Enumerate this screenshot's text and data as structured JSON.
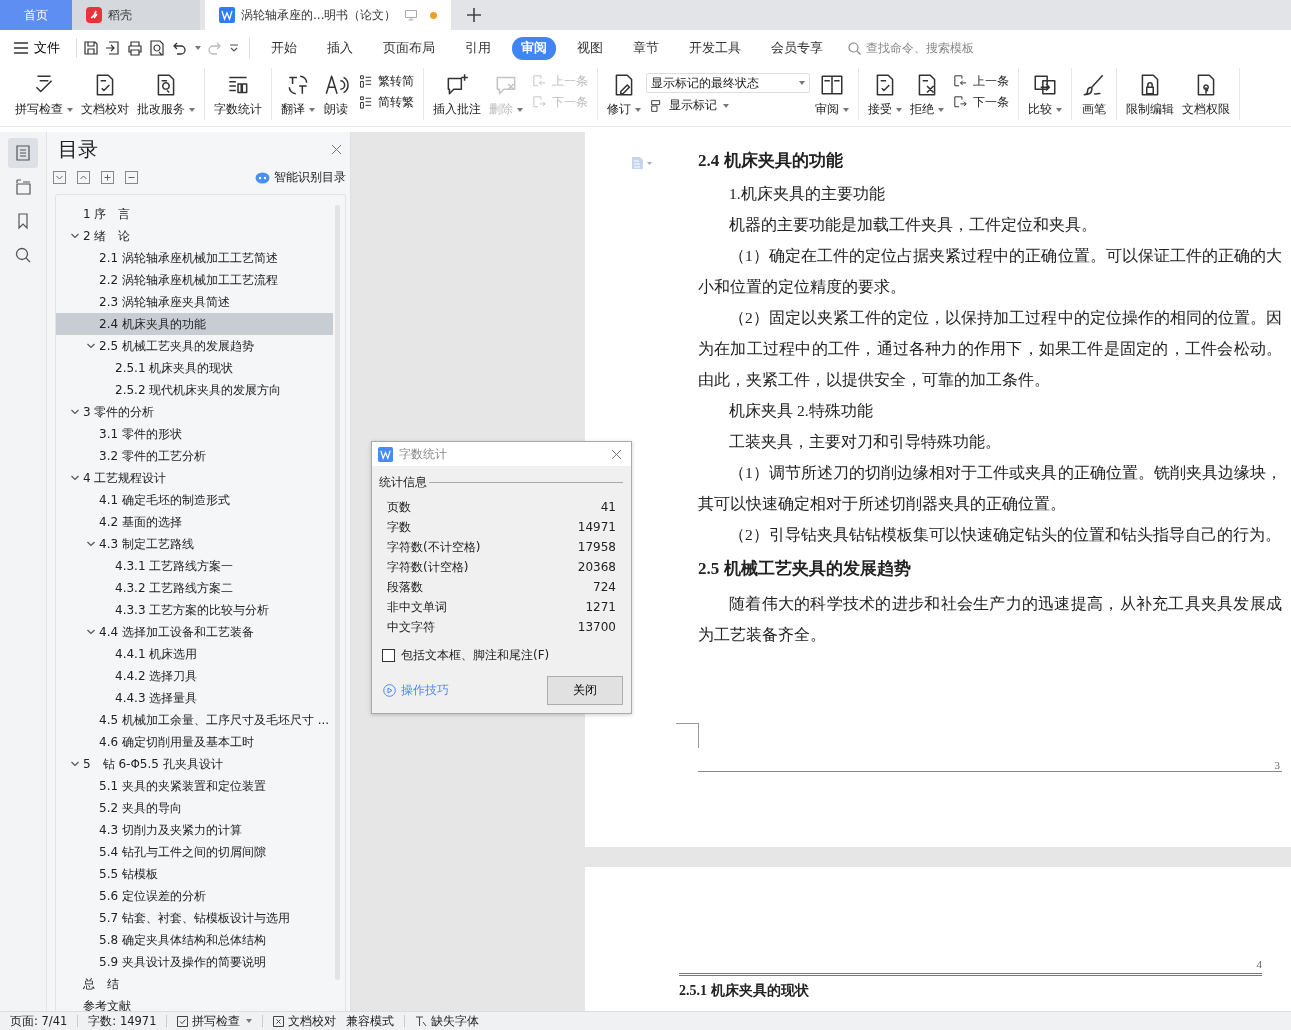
{
  "title_tabs": [
    {
      "label": "首页",
      "kind": "home",
      "selected": false
    },
    {
      "label": "稻壳",
      "kind": "app",
      "selected": false
    },
    {
      "label": "涡轮轴承座的...明书（论文）",
      "kind": "doc",
      "selected": true,
      "modified": true
    }
  ],
  "menu": {
    "file_label": "文件",
    "tabs": [
      {
        "label": "开始",
        "selected": false
      },
      {
        "label": "插入",
        "selected": false
      },
      {
        "label": "页面布局",
        "selected": false
      },
      {
        "label": "引用",
        "selected": false
      },
      {
        "label": "审阅",
        "selected": true
      },
      {
        "label": "视图",
        "selected": false
      },
      {
        "label": "章节",
        "selected": false
      },
      {
        "label": "开发工具",
        "selected": false
      },
      {
        "label": "会员专享",
        "selected": false
      }
    ],
    "search": {
      "placeholder": "查找命令、搜索模板"
    }
  },
  "ribbon": [
    [
      {
        "kind": "button",
        "label": "拼写检查",
        "dropdown": true,
        "disabled": false
      },
      {
        "kind": "button",
        "label": "文档校对",
        "dropdown": false,
        "disabled": false
      },
      {
        "kind": "button",
        "label": "批改服务",
        "dropdown": true,
        "disabled": false
      }
    ],
    [
      {
        "kind": "button",
        "label": "字数统计",
        "dropdown": false,
        "disabled": false
      }
    ],
    [
      {
        "kind": "button",
        "label": "翻译",
        "dropdown": true,
        "disabled": false
      },
      {
        "kind": "button",
        "label": "朗读",
        "dropdown": false,
        "disabled": false
      },
      {
        "kind": "pair",
        "rows": [
          {
            "label": "繁转简",
            "disabled": false
          },
          {
            "label": "简转繁",
            "disabled": false
          }
        ]
      }
    ],
    [
      {
        "kind": "button",
        "label": "插入批注",
        "dropdown": false,
        "disabled": false
      },
      {
        "kind": "button",
        "label": "删除",
        "dropdown": true,
        "disabled": true
      },
      {
        "kind": "pair",
        "rows": [
          {
            "label": "上一条",
            "disabled": true
          },
          {
            "label": "下一条",
            "disabled": true
          }
        ]
      }
    ],
    [
      {
        "kind": "button",
        "label": "修订",
        "dropdown": true,
        "disabled": false
      },
      {
        "kind": "select",
        "value": "显示标记的最终状态",
        "below": {
          "label": "显示标记",
          "dropdown": true
        }
      },
      {
        "kind": "button",
        "label": "审阅",
        "dropdown": true,
        "disabled": false
      }
    ],
    [
      {
        "kind": "button",
        "label": "接受",
        "dropdown": true,
        "disabled": false
      },
      {
        "kind": "button",
        "label": "拒绝",
        "dropdown": true,
        "disabled": false
      },
      {
        "kind": "pair",
        "rows": [
          {
            "label": "上一条",
            "disabled": false
          },
          {
            "label": "下一条",
            "disabled": false
          }
        ]
      }
    ],
    [
      {
        "kind": "button",
        "label": "比较",
        "dropdown": true,
        "disabled": false
      }
    ],
    [
      {
        "kind": "button",
        "label": "画笔",
        "dropdown": false,
        "disabled": false
      }
    ],
    [
      {
        "kind": "button",
        "label": "限制编辑",
        "dropdown": false,
        "disabled": false
      },
      {
        "kind": "button",
        "label": "文档权限",
        "dropdown": false,
        "disabled": false
      }
    ]
  ],
  "toc": {
    "title": "目录",
    "smart_label": "智能识别目录",
    "items": [
      {
        "label": "1 序　言",
        "selected": false
      },
      {
        "label": "2 绪　论",
        "selected": false,
        "expanded": true,
        "children": [
          {
            "label": "2.1  涡轮轴承座机械加工工艺简述",
            "selected": false
          },
          {
            "label": "2.2 涡轮轴承座机械加工工艺流程",
            "selected": false
          },
          {
            "label": "2.3 涡轮轴承座夹具简述",
            "selected": false
          },
          {
            "label": "2.4 机床夹具的功能",
            "selected": true
          },
          {
            "label": "2.5 机械工艺夹具的发展趋势",
            "selected": false,
            "expanded": true,
            "children": [
              {
                "label": "2.5.1 机床夹具的现状",
                "selected": false
              },
              {
                "label": "2.5.2 现代机床夹具的发展方向",
                "selected": false
              }
            ]
          }
        ]
      },
      {
        "label": "3  零件的分析",
        "selected": false,
        "expanded": true,
        "children": [
          {
            "label": "3.1 零件的形状",
            "selected": false
          },
          {
            "label": "3.2 零件的工艺分析",
            "selected": false
          }
        ]
      },
      {
        "label": "4  工艺规程设计",
        "selected": false,
        "expanded": true,
        "children": [
          {
            "label": "4.1  确定毛坯的制造形式",
            "selected": false
          },
          {
            "label": "4.2  基面的选择",
            "selected": false
          },
          {
            "label": "4.3  制定工艺路线",
            "selected": false,
            "expanded": true,
            "children": [
              {
                "label": "4.3.1  工艺路线方案一",
                "selected": false
              },
              {
                "label": "4.3.2  工艺路线方案二",
                "selected": false
              },
              {
                "label": "4.3.3  工艺方案的比较与分析",
                "selected": false
              }
            ]
          },
          {
            "label": "4.4  选择加工设备和工艺装备",
            "selected": false,
            "expanded": true,
            "children": [
              {
                "label": "4.4.1  机床选用",
                "selected": false
              },
              {
                "label": "4.4.2  选择刀具",
                "selected": false
              },
              {
                "label": "4.4.3  选择量具",
                "selected": false
              }
            ]
          },
          {
            "label": "4.5  机械加工余量、工序尺寸及毛坯尺寸 ...",
            "selected": false
          },
          {
            "label": "4.6 确定切削用量及基本工时",
            "selected": false
          }
        ]
      },
      {
        "label": "5　钻 6-Φ5.5 孔夹具设计",
        "selected": false,
        "expanded": true,
        "children": [
          {
            "label": "5.1  夹具的夹紧装置和定位装置",
            "selected": false
          },
          {
            "label": "5.2  夹具的导向",
            "selected": false
          },
          {
            "label": "4.3  切削力及夹紧力的计算",
            "selected": false
          },
          {
            "label": "5.4  钻孔与工件之间的切屑间隙",
            "selected": false
          },
          {
            "label": "5.5  钻模板",
            "selected": false
          },
          {
            "label": "5.6 定位误差的分析",
            "selected": false
          },
          {
            "label": "5.7  钻套、衬套、钻模板设计与选用",
            "selected": false
          },
          {
            "label": "5.8  确定夹具体结构和总体结构",
            "selected": false
          },
          {
            "label": "5.9  夹具设计及操作的简要说明",
            "selected": false
          }
        ]
      },
      {
        "label": "总　结",
        "selected": false
      },
      {
        "label": "参考文献",
        "selected": false
      }
    ]
  },
  "pages": [
    {
      "number": "3",
      "blocks": [
        {
          "kind": "heading",
          "text": "2.4 机床夹具的功能"
        },
        {
          "kind": "para",
          "text": "1.机床夹具的主要功能"
        },
        {
          "kind": "para",
          "text": "机器的主要功能是加载工件夹具，工件定位和夹具。"
        },
        {
          "kind": "para",
          "text": "（1）确定在工件的定位占据夹紧过程中的正确位置。可以保证工件的正确的大小和位置的定位精度的要求。"
        },
        {
          "kind": "para",
          "text": "（2）固定以夹紧工件的定位，以保持加工过程中的定位操作的相同的位置。因为在加工过程中的工件，通过各种力的作用下，如果工件是固定的，工件会松动。由此，夹紧工件，以提供安全，可靠的加工条件。"
        },
        {
          "kind": "para",
          "text": "机床夹具 2.特殊功能"
        },
        {
          "kind": "para",
          "text": "工装夹具，主要对刀和引导特殊功能。"
        },
        {
          "kind": "para",
          "text": "（1）调节所述刀的切削边缘相对于工件或夹具的正确位置。铣削夹具边缘块，其可以快速确定相对于所述切削器夹具的正确位置。"
        },
        {
          "kind": "para",
          "text": "（2）引导钻夹具钻钻模板集可以快速确定钻头的位置和钻头指导自己的行为。"
        },
        {
          "kind": "heading",
          "text": "2.5 机械工艺夹具的发展趋势"
        },
        {
          "kind": "para",
          "text": "随着伟大的科学技术的进步和社会生产力的迅速提高，从补充工具夹具发展成为工艺装备齐全。"
        }
      ]
    },
    {
      "number": "4",
      "blocks": [
        {
          "kind": "subheading",
          "text": "2.5.1 机床夹具的现状"
        }
      ]
    }
  ],
  "dialog": {
    "title": "字数统计",
    "section": "统计信息",
    "rows": [
      {
        "label": "页数",
        "value": "41"
      },
      {
        "label": "字数",
        "value": "14971"
      },
      {
        "label": "字符数(不计空格)",
        "value": "17958"
      },
      {
        "label": "字符数(计空格)",
        "value": "20368"
      },
      {
        "label": "段落数",
        "value": "724"
      },
      {
        "label": "非中文单词",
        "value": "1271"
      },
      {
        "label": "中文字符",
        "value": "13700"
      }
    ],
    "include_checkbox": {
      "label": "包括文本框、脚注和尾注(F)",
      "checked": false
    },
    "tips_link": "操作技巧",
    "close_button": "关闭"
  },
  "status_bar": {
    "page": "页面: 7/41",
    "words": "字数: 14971",
    "spell": "拼写检查",
    "proof": "文档校对",
    "compat": "兼容模式",
    "fonts": "缺失字体"
  }
}
